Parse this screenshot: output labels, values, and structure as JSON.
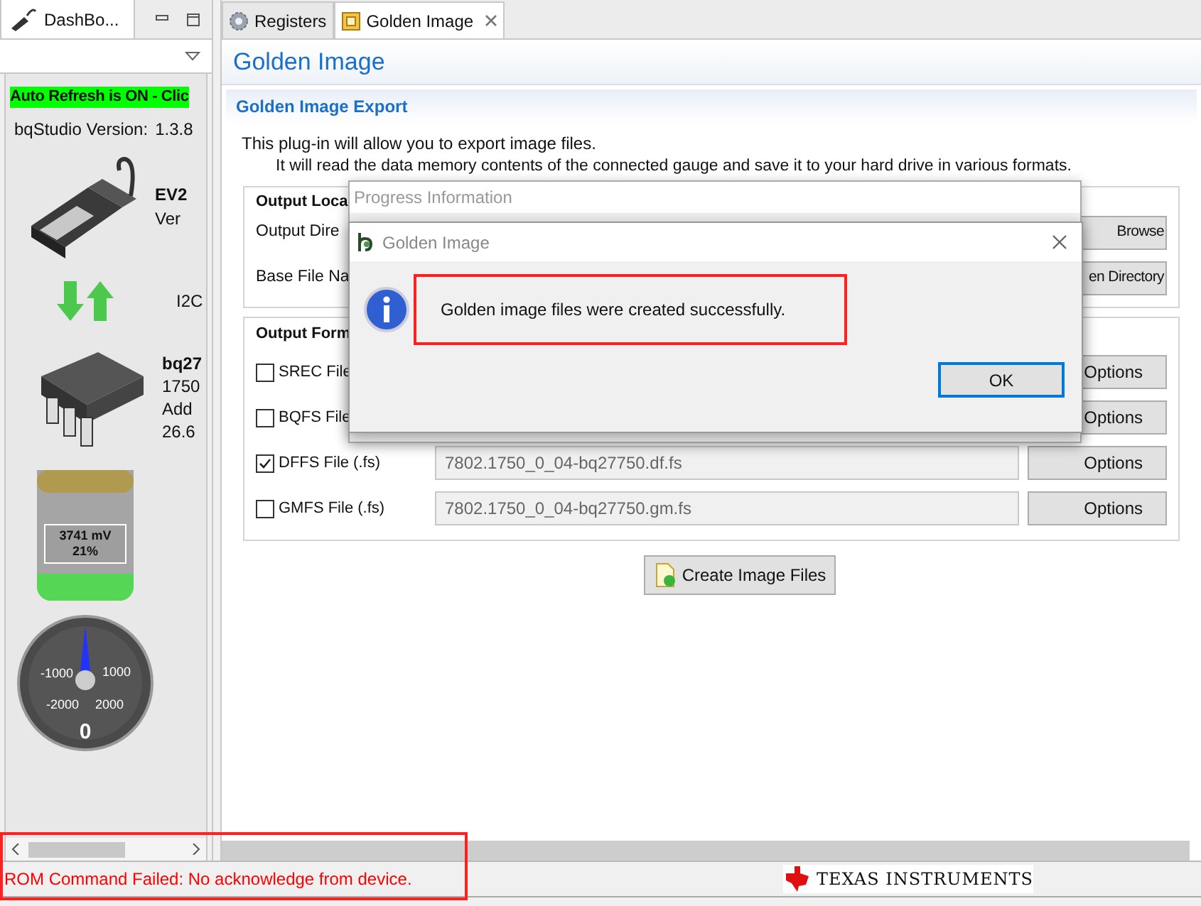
{
  "left_panel": {
    "tab": {
      "label": "DashBo...",
      "selected": true
    },
    "auto_refresh": "Auto Refresh is ON - Clic",
    "version_label": "bqStudio Version:",
    "version_value": "1.3.8",
    "adapter_lines": [
      "EV2",
      "Ver"
    ],
    "interface": "I2C",
    "device_lines": [
      "bq27",
      "1750",
      "Add",
      "26.6"
    ],
    "battery": {
      "voltage": "3741 mV",
      "charge": "21%",
      "level": 0.21
    },
    "gauge": {
      "labels": [
        "-1000",
        "1000",
        "-2000",
        "2000"
      ],
      "reading": "0"
    }
  },
  "tabs": [
    {
      "label": "Registers",
      "selected": false,
      "kind": "gear"
    },
    {
      "label": "Golden Image",
      "selected": true,
      "kind": "chip"
    }
  ],
  "page_title": "Golden Image",
  "section_title": "Golden Image Export",
  "description": [
    "This plug-in will allow you to export image files.",
    "It will read the data memory contents of the connected gauge and save it to your hard drive in various formats."
  ],
  "output_location": {
    "title": "Output Loca",
    "rows": [
      {
        "label": "Output Dire",
        "button": "Browse"
      },
      {
        "label": "Base File Na",
        "button": "en Directory"
      }
    ]
  },
  "output_format": {
    "title": "Output Form",
    "rows": [
      {
        "label": "SREC File",
        "checked": false,
        "button": "Options"
      },
      {
        "label": "BQFS File",
        "checked": false,
        "button": "Options"
      },
      {
        "label": "DFFS File (.fs)",
        "checked": true,
        "value": "7802.1750_0_04-bq27750.df.fs",
        "button": "Options"
      },
      {
        "label": "GMFS File (.fs)",
        "checked": false,
        "value": "7802.1750_0_04-bq27750.gm.fs",
        "button": "Options"
      }
    ]
  },
  "create_button": "Create Image Files",
  "progress_dialog": {
    "title": "Progress Information"
  },
  "message_dialog": {
    "title": "Golden Image",
    "message": "Golden image files were created successfully.",
    "button": "OK"
  },
  "status_bar": {
    "message": "ROM Command Failed: No acknowledge from device.",
    "logo": "TEXAS INSTRUMENTS"
  }
}
